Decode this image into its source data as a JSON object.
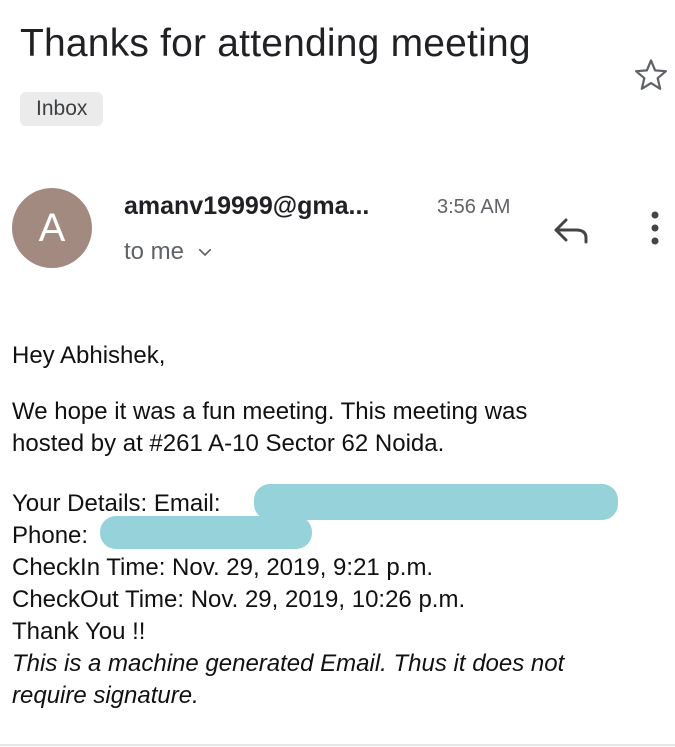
{
  "email": {
    "subject": "Thanks for attending meeting",
    "label": "Inbox",
    "avatar_letter": "A",
    "sender": "amanv19999@gma...",
    "time": "3:56 AM",
    "recipient": "to me"
  },
  "body": {
    "greeting": "Hey Abhishek,",
    "line1": "We hope it was a fun meeting. This meeting was",
    "line2": "hosted by at #261 A-10 Sector 62 Noida.",
    "details_email_label": "Your Details: Email:",
    "phone_label": "Phone:",
    "checkin": "CheckIn Time: Nov. 29, 2019, 9:21 p.m.",
    "checkout": "CheckOut Time: Nov. 29, 2019, 10:26 p.m.",
    "thanks": "Thank You !!",
    "footer_line1": "This is a machine generated Email. Thus it does not",
    "footer_line2": "require signature."
  },
  "icons": {
    "star": "star-outline-icon",
    "reply": "reply-icon",
    "more": "more-vert-icon",
    "chevron": "chevron-down-icon"
  },
  "colors": {
    "avatar_bg": "#a28a80",
    "chip_bg": "#ebebeb",
    "redaction": "#96d2d9"
  }
}
